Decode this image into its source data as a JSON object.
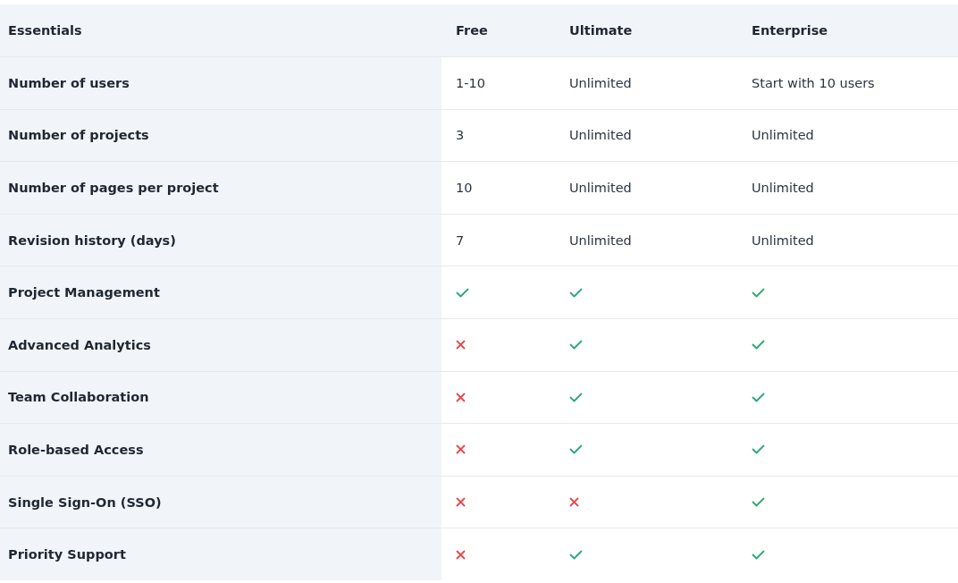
{
  "table": {
    "columns": [
      "Essentials",
      "Free",
      "Ultimate",
      "Enterprise"
    ],
    "rows": [
      {
        "cells": [
          {
            "kind": "label",
            "text": "Number of users"
          },
          {
            "kind": "text",
            "text": "1-10"
          },
          {
            "kind": "text",
            "text": "Unlimited"
          },
          {
            "kind": "text",
            "text": "Start with 10 users"
          }
        ]
      },
      {
        "cells": [
          {
            "kind": "label",
            "text": "Number of projects"
          },
          {
            "kind": "text",
            "text": "3"
          },
          {
            "kind": "text",
            "text": "Unlimited"
          },
          {
            "kind": "text",
            "text": "Unlimited"
          }
        ]
      },
      {
        "cells": [
          {
            "kind": "label",
            "text": "Number of pages per project"
          },
          {
            "kind": "text",
            "text": "10"
          },
          {
            "kind": "text",
            "text": "Unlimited"
          },
          {
            "kind": "text",
            "text": "Unlimited"
          }
        ]
      },
      {
        "cells": [
          {
            "kind": "label",
            "text": "Revision history (days)"
          },
          {
            "kind": "text",
            "text": "7"
          },
          {
            "kind": "text",
            "text": "Unlimited"
          },
          {
            "kind": "text",
            "text": "Unlimited"
          }
        ]
      },
      {
        "cells": [
          {
            "kind": "label",
            "text": "Project Management"
          },
          {
            "kind": "mark",
            "included": true
          },
          {
            "kind": "mark",
            "included": true
          },
          {
            "kind": "mark",
            "included": true
          }
        ]
      },
      {
        "cells": [
          {
            "kind": "label",
            "text": "Advanced Analytics"
          },
          {
            "kind": "mark",
            "included": false
          },
          {
            "kind": "mark",
            "included": true
          },
          {
            "kind": "mark",
            "included": true
          }
        ]
      },
      {
        "cells": [
          {
            "kind": "label",
            "text": "Team Collaboration"
          },
          {
            "kind": "mark",
            "included": false
          },
          {
            "kind": "mark",
            "included": true
          },
          {
            "kind": "mark",
            "included": true
          }
        ]
      },
      {
        "cells": [
          {
            "kind": "label",
            "text": "Role-based Access"
          },
          {
            "kind": "mark",
            "included": false
          },
          {
            "kind": "mark",
            "included": true
          },
          {
            "kind": "mark",
            "included": true
          }
        ]
      },
      {
        "cells": [
          {
            "kind": "label",
            "text": "Single Sign-On (SSO)"
          },
          {
            "kind": "mark",
            "included": false
          },
          {
            "kind": "mark",
            "included": false
          },
          {
            "kind": "mark",
            "included": true
          }
        ]
      },
      {
        "cells": [
          {
            "kind": "label",
            "text": "Priority Support"
          },
          {
            "kind": "mark",
            "included": false
          },
          {
            "kind": "mark",
            "included": true
          },
          {
            "kind": "mark",
            "included": true
          }
        ]
      }
    ]
  }
}
